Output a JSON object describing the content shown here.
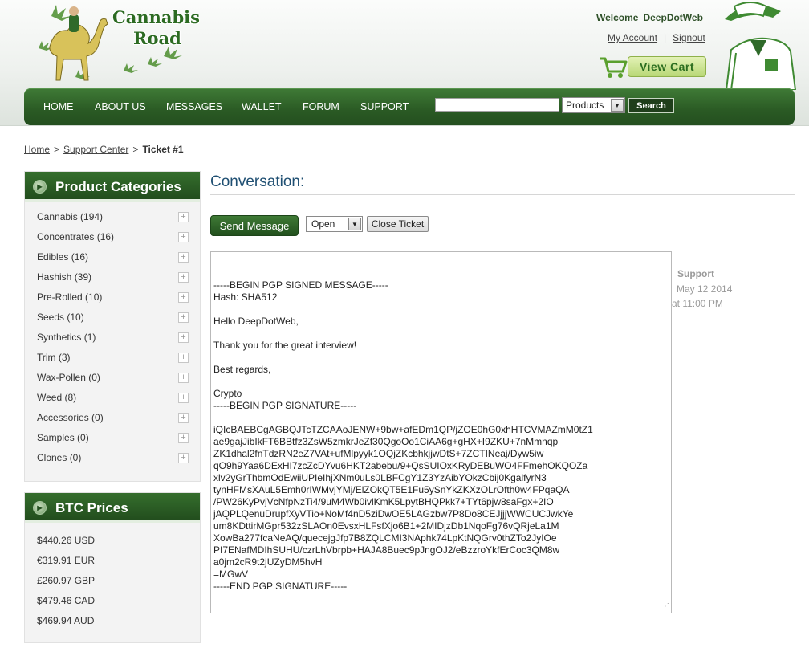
{
  "header": {
    "logo_line1": "Cannabis",
    "logo_line2": "Road",
    "welcome_label": "Welcome",
    "username": "DeepDotWeb",
    "my_account": "My Account",
    "signout": "Signout",
    "view_cart": "View Cart"
  },
  "nav": {
    "items": [
      "HOME",
      "ABOUT US",
      "MESSAGES",
      "WALLET",
      "FORUM",
      "SUPPORT"
    ],
    "search_value": "",
    "search_category": "Products",
    "search_button": "Search"
  },
  "breadcrumb": {
    "home": "Home",
    "support_center": "Support Center",
    "current": "Ticket #1",
    "separator": ">"
  },
  "categories": {
    "title": "Product Categories",
    "items": [
      "Cannabis (194)",
      "Concentrates (16)",
      "Edibles (16)",
      "Hashish (39)",
      "Pre-Rolled (10)",
      "Seeds (10)",
      "Synthetics (1)",
      "Trim (3)",
      "Wax-Pollen (0)",
      "Weed (8)",
      "Accessories (0)",
      "Samples (0)",
      "Clones (0)"
    ]
  },
  "btc": {
    "title": "BTC Prices",
    "prices": [
      "$440.26 USD",
      "€319.91 EUR",
      "£260.97 GBP",
      "$479.46 CAD",
      "$469.94 AUD"
    ]
  },
  "conversation": {
    "title": "Conversation:",
    "send_button": "Send Message",
    "status_value": "Open",
    "close_button": "Close Ticket",
    "message_text": "-----BEGIN PGP SIGNED MESSAGE-----\nHash: SHA512\n\nHello DeepDotWeb,\n\nThank you for the great interview!\n\nBest regards,\n\nCrypto\n-----BEGIN PGP SIGNATURE-----\n\niQIcBAEBCgAGBQJTcTZCAAoJENW+9bw+afEDm1QP/jZOE0hG0xhHTCVMAZmM0tZ1\nae9gajJibIkFT6BBtfz3ZsW5zmkrJeZf30QgoOo1CiAA6g+gHX+I9ZKU+7nMmnqp\nZK1dhal2fnTdzRN2eZ7VAt+ufMlpyyk1OQjZKcbhkjjwDtS+7ZCTINeaj/Dyw5iw\nqO9h9Yaa6DExHI7zcZcDYvu6HKT2abebu/9+QsSUIOxKRyDEBuWO4FFmehOKQOZa\nxlv2yGrThbmOdEwiiUPIeIhjXNm0uLs0LBFCgY1Z3YzAibYOkzCbij0KgalfyrN3\ntynHFMsXAuL5Emh0rIWMvjYMj/ElZOkQT5E1Fu5ySnYkZKXzOLrOfth0w4FPqaQA\n/PW26KyPvjVcNfpNzTi4/9uM4Wb0ivlKmK5LpytBHQPkk7+TYt6pjw8saFgx+2IO\njAQPLQenuDrupfXyVTio+NoMf4nD5ziDwOE5LAGzbw7P8Do8CEJjjjWWCUCJwkYe\num8KDttirMGpr532zSLAOn0EvsxHLFsfXjo6B1+2MIDjzDb1NqoFg76vQRjeLa1M\nXowBa277fcaNeAQ/quecejgJfp7B8ZQLCMI3NAphk74LpKtNQGrv0thZTo2JyIOe\nPI7ENafMDIhSUHU/czrLhVbrpb+HAJA8Buec9pJngOJ2/eBzzroYkfErCoc3QM8w\na0jm2cR9t2jUZyDM5hvH\n=MGwV\n-----END PGP SIGNATURE-----",
    "author": "Support",
    "date": "May 12 2014",
    "time": "at 11:00 PM"
  },
  "colors": {
    "nav_green": "#2a5a24",
    "link_blue": "#1f4f72",
    "brand_light_green": "#b9d877"
  }
}
